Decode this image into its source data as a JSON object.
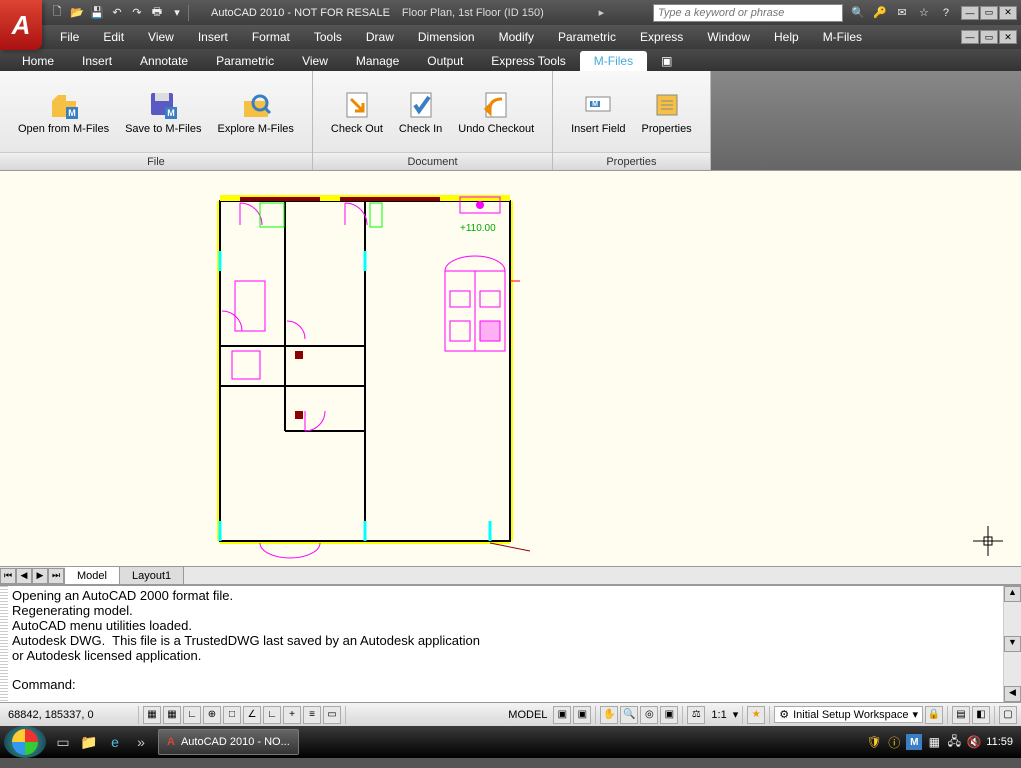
{
  "title": {
    "app": "AutoCAD 2010 - NOT FOR RESALE",
    "file": "Floor Plan, 1st Floor (ID 150)"
  },
  "search": {
    "placeholder": "Type a keyword or phrase"
  },
  "menus": [
    "File",
    "Edit",
    "View",
    "Insert",
    "Format",
    "Tools",
    "Draw",
    "Dimension",
    "Modify",
    "Parametric",
    "Express",
    "Window",
    "Help",
    "M-Files"
  ],
  "ribbon_tabs": [
    "Home",
    "Insert",
    "Annotate",
    "Parametric",
    "View",
    "Manage",
    "Output",
    "Express Tools",
    "M-Files"
  ],
  "active_tab": "M-Files",
  "panels": {
    "file": {
      "title": "File",
      "buttons": [
        {
          "label": "Open from M-Files"
        },
        {
          "label": "Save to M-Files"
        },
        {
          "label": "Explore M-Files"
        }
      ]
    },
    "document": {
      "title": "Document",
      "buttons": [
        {
          "label": "Check Out"
        },
        {
          "label": "Check In"
        },
        {
          "label": "Undo Checkout"
        }
      ]
    },
    "properties": {
      "title": "Properties",
      "buttons": [
        {
          "label": "Insert Field"
        },
        {
          "label": "Properties"
        }
      ]
    }
  },
  "drawing": {
    "annotation": "+110.00"
  },
  "model_tabs": {
    "model": "Model",
    "layout1": "Layout1"
  },
  "cmd": {
    "lines": [
      "Opening an AutoCAD 2000 format file.",
      "Regenerating model.",
      "AutoCAD menu utilities loaded.",
      "Autodesk DWG.  This file is a TrustedDWG last saved by an Autodesk application",
      "or Autodesk licensed application."
    ],
    "prompt": "Command:"
  },
  "status": {
    "coords": "68842, 185337, 0",
    "model": "MODEL",
    "scale": "1:1",
    "workspace": "Initial Setup Workspace"
  },
  "taskbar": {
    "app": "AutoCAD 2010 - NO...",
    "clock": "11:59"
  }
}
